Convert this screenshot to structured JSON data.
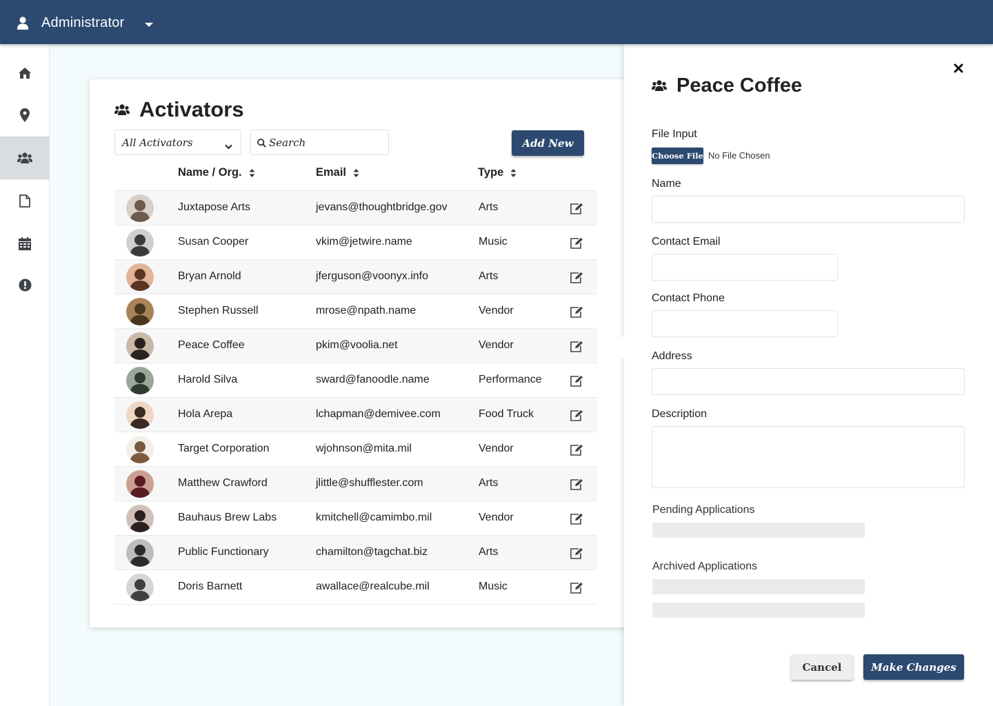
{
  "topbar": {
    "user_name": "Administrator",
    "user_icon": "user-icon",
    "menu_icon": "caret-down-icon"
  },
  "sidebar": {
    "items": [
      {
        "name": "home",
        "icon": "home-icon",
        "active": false
      },
      {
        "name": "locations",
        "icon": "map-marker-icon",
        "active": false
      },
      {
        "name": "activators",
        "icon": "users-icon",
        "active": true
      },
      {
        "name": "documents",
        "icon": "file-icon",
        "active": false
      },
      {
        "name": "calendar",
        "icon": "calendar-icon",
        "active": false
      },
      {
        "name": "alerts",
        "icon": "exclamation-circle-icon",
        "active": false
      }
    ]
  },
  "main": {
    "title": "Activators",
    "filter_value": "All Activators",
    "search_placeholder": "Search",
    "add_label": "Add New",
    "columns": [
      "Name / Org.",
      "Email",
      "Type"
    ],
    "rows": [
      {
        "name": "Juxtapose Arts",
        "email": "jevans@thoughtbridge.gov",
        "type": "Arts"
      },
      {
        "name": "Susan Cooper",
        "email": "vkim@jetwire.name",
        "type": "Music"
      },
      {
        "name": "Bryan Arnold",
        "email": "jferguson@voonyx.info",
        "type": "Arts"
      },
      {
        "name": "Stephen Russell",
        "email": "mrose@npath.name",
        "type": "Vendor"
      },
      {
        "name": "Peace Coffee",
        "email": "pkim@voolia.net",
        "type": "Vendor"
      },
      {
        "name": "Harold Silva",
        "email": "sward@fanoodle.name",
        "type": "Performance"
      },
      {
        "name": "Hola Arepa",
        "email": "lchapman@demivee.com",
        "type": "Food Truck"
      },
      {
        "name": "Target Corporation",
        "email": "wjohnson@mita.mil",
        "type": "Vendor"
      },
      {
        "name": "Matthew Crawford",
        "email": "jlittle@shufflester.com",
        "type": "Arts"
      },
      {
        "name": "Bauhaus Brew Labs",
        "email": "kmitchell@camimbo.mil",
        "type": "Vendor"
      },
      {
        "name": "Public Functionary",
        "email": "chamilton@tagchat.biz",
        "type": "Arts"
      },
      {
        "name": "Doris Barnett",
        "email": "awallace@realcube.mil",
        "type": "Music"
      }
    ]
  },
  "panel": {
    "title": "Peace Coffee",
    "file_label": "File Input",
    "choose_file": "Choose File",
    "no_file": "No File Chosen",
    "name_label": "Name",
    "email_label": "Contact Email",
    "phone_label": "Contact Phone",
    "address_label": "Address",
    "description_label": "Description",
    "pending_label": "Pending Applications",
    "archived_label": "Archived Applications",
    "cancel_label": "Cancel",
    "submit_label": "Make Changes"
  },
  "colors": {
    "primary": "#2c4a6f",
    "background": "#f3fbfc"
  }
}
